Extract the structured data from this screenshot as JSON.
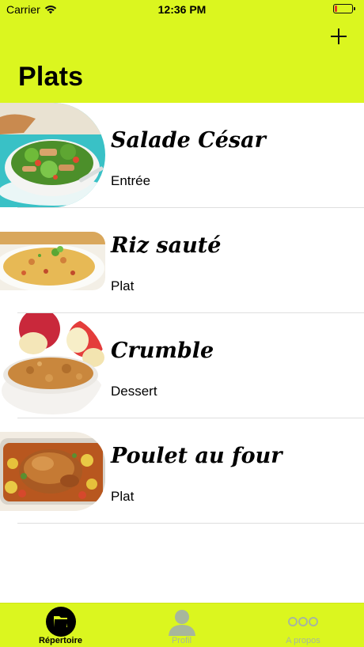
{
  "status_bar": {
    "carrier": "Carrier",
    "time": "12:36 PM",
    "battery_level": 0.15
  },
  "header": {
    "title": "Plats",
    "add_icon": "plus-icon"
  },
  "dishes": [
    {
      "name": "Salade César",
      "category": "Entrée"
    },
    {
      "name": "Riz sauté",
      "category": "Plat"
    },
    {
      "name": "Crumble",
      "category": "Dessert"
    },
    {
      "name": "Poulet au four",
      "category": "Plat"
    }
  ],
  "tab_bar": {
    "tabs": [
      {
        "label": "Répertoire",
        "icon": "folder-icon",
        "active": true
      },
      {
        "label": "Profil",
        "icon": "person-icon",
        "active": false
      },
      {
        "label": "A propos",
        "icon": "more-icon",
        "active": false
      }
    ]
  },
  "colors": {
    "accent": "#dbf61f",
    "inactive_tab": "#a7b79c"
  }
}
